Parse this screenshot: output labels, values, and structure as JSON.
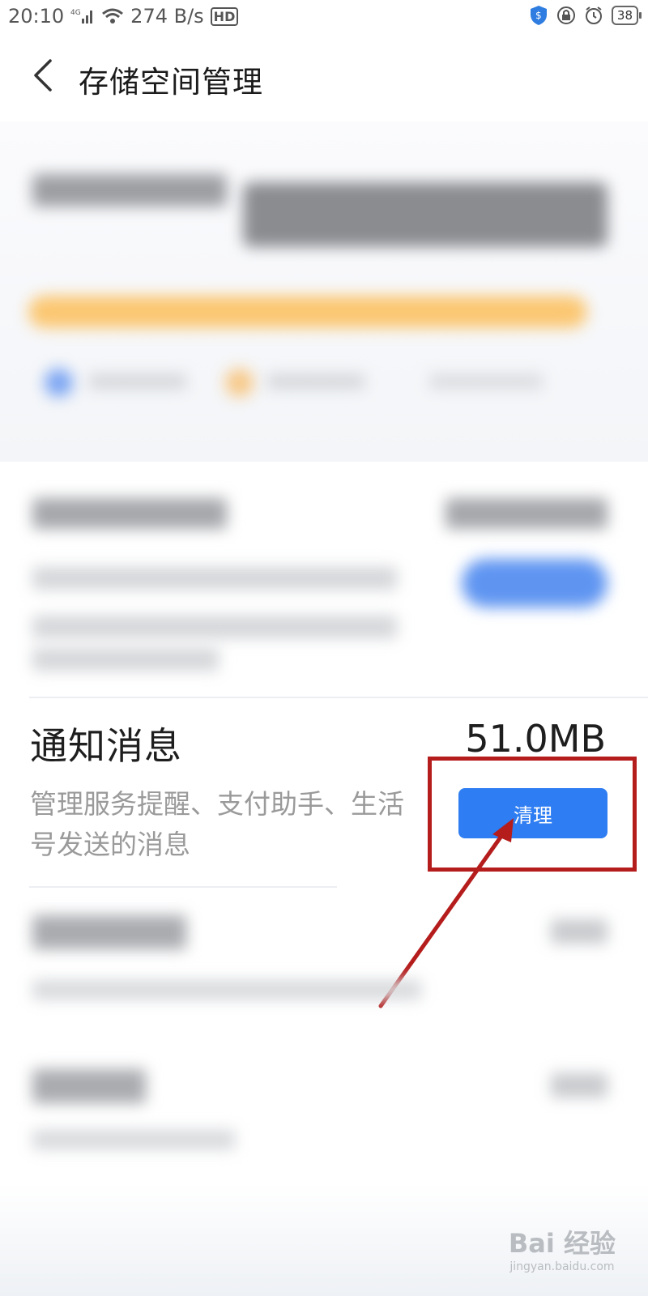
{
  "status_bar": {
    "time": "20:10",
    "network": "4G",
    "speed": "274 B/s",
    "hd": "HD",
    "battery": "38",
    "icons": [
      "signal-icon",
      "wifi-icon",
      "shield-icon",
      "lock-icon",
      "alarm-icon",
      "battery-icon"
    ]
  },
  "header": {
    "back_icon": "chevron-left-icon",
    "title": "存储空间管理"
  },
  "notification_section": {
    "title": "通知消息",
    "size": "51.0MB",
    "description": "管理服务提醒、支付助手、生活号发送的消息",
    "clean_button": "清理"
  },
  "colors": {
    "accent": "#2e7df2",
    "highlight": "#b51d1c",
    "storage_bar": "#fbc772"
  },
  "watermark": {
    "logo": "Bai 经验",
    "url": "jingyan.baidu.com"
  }
}
